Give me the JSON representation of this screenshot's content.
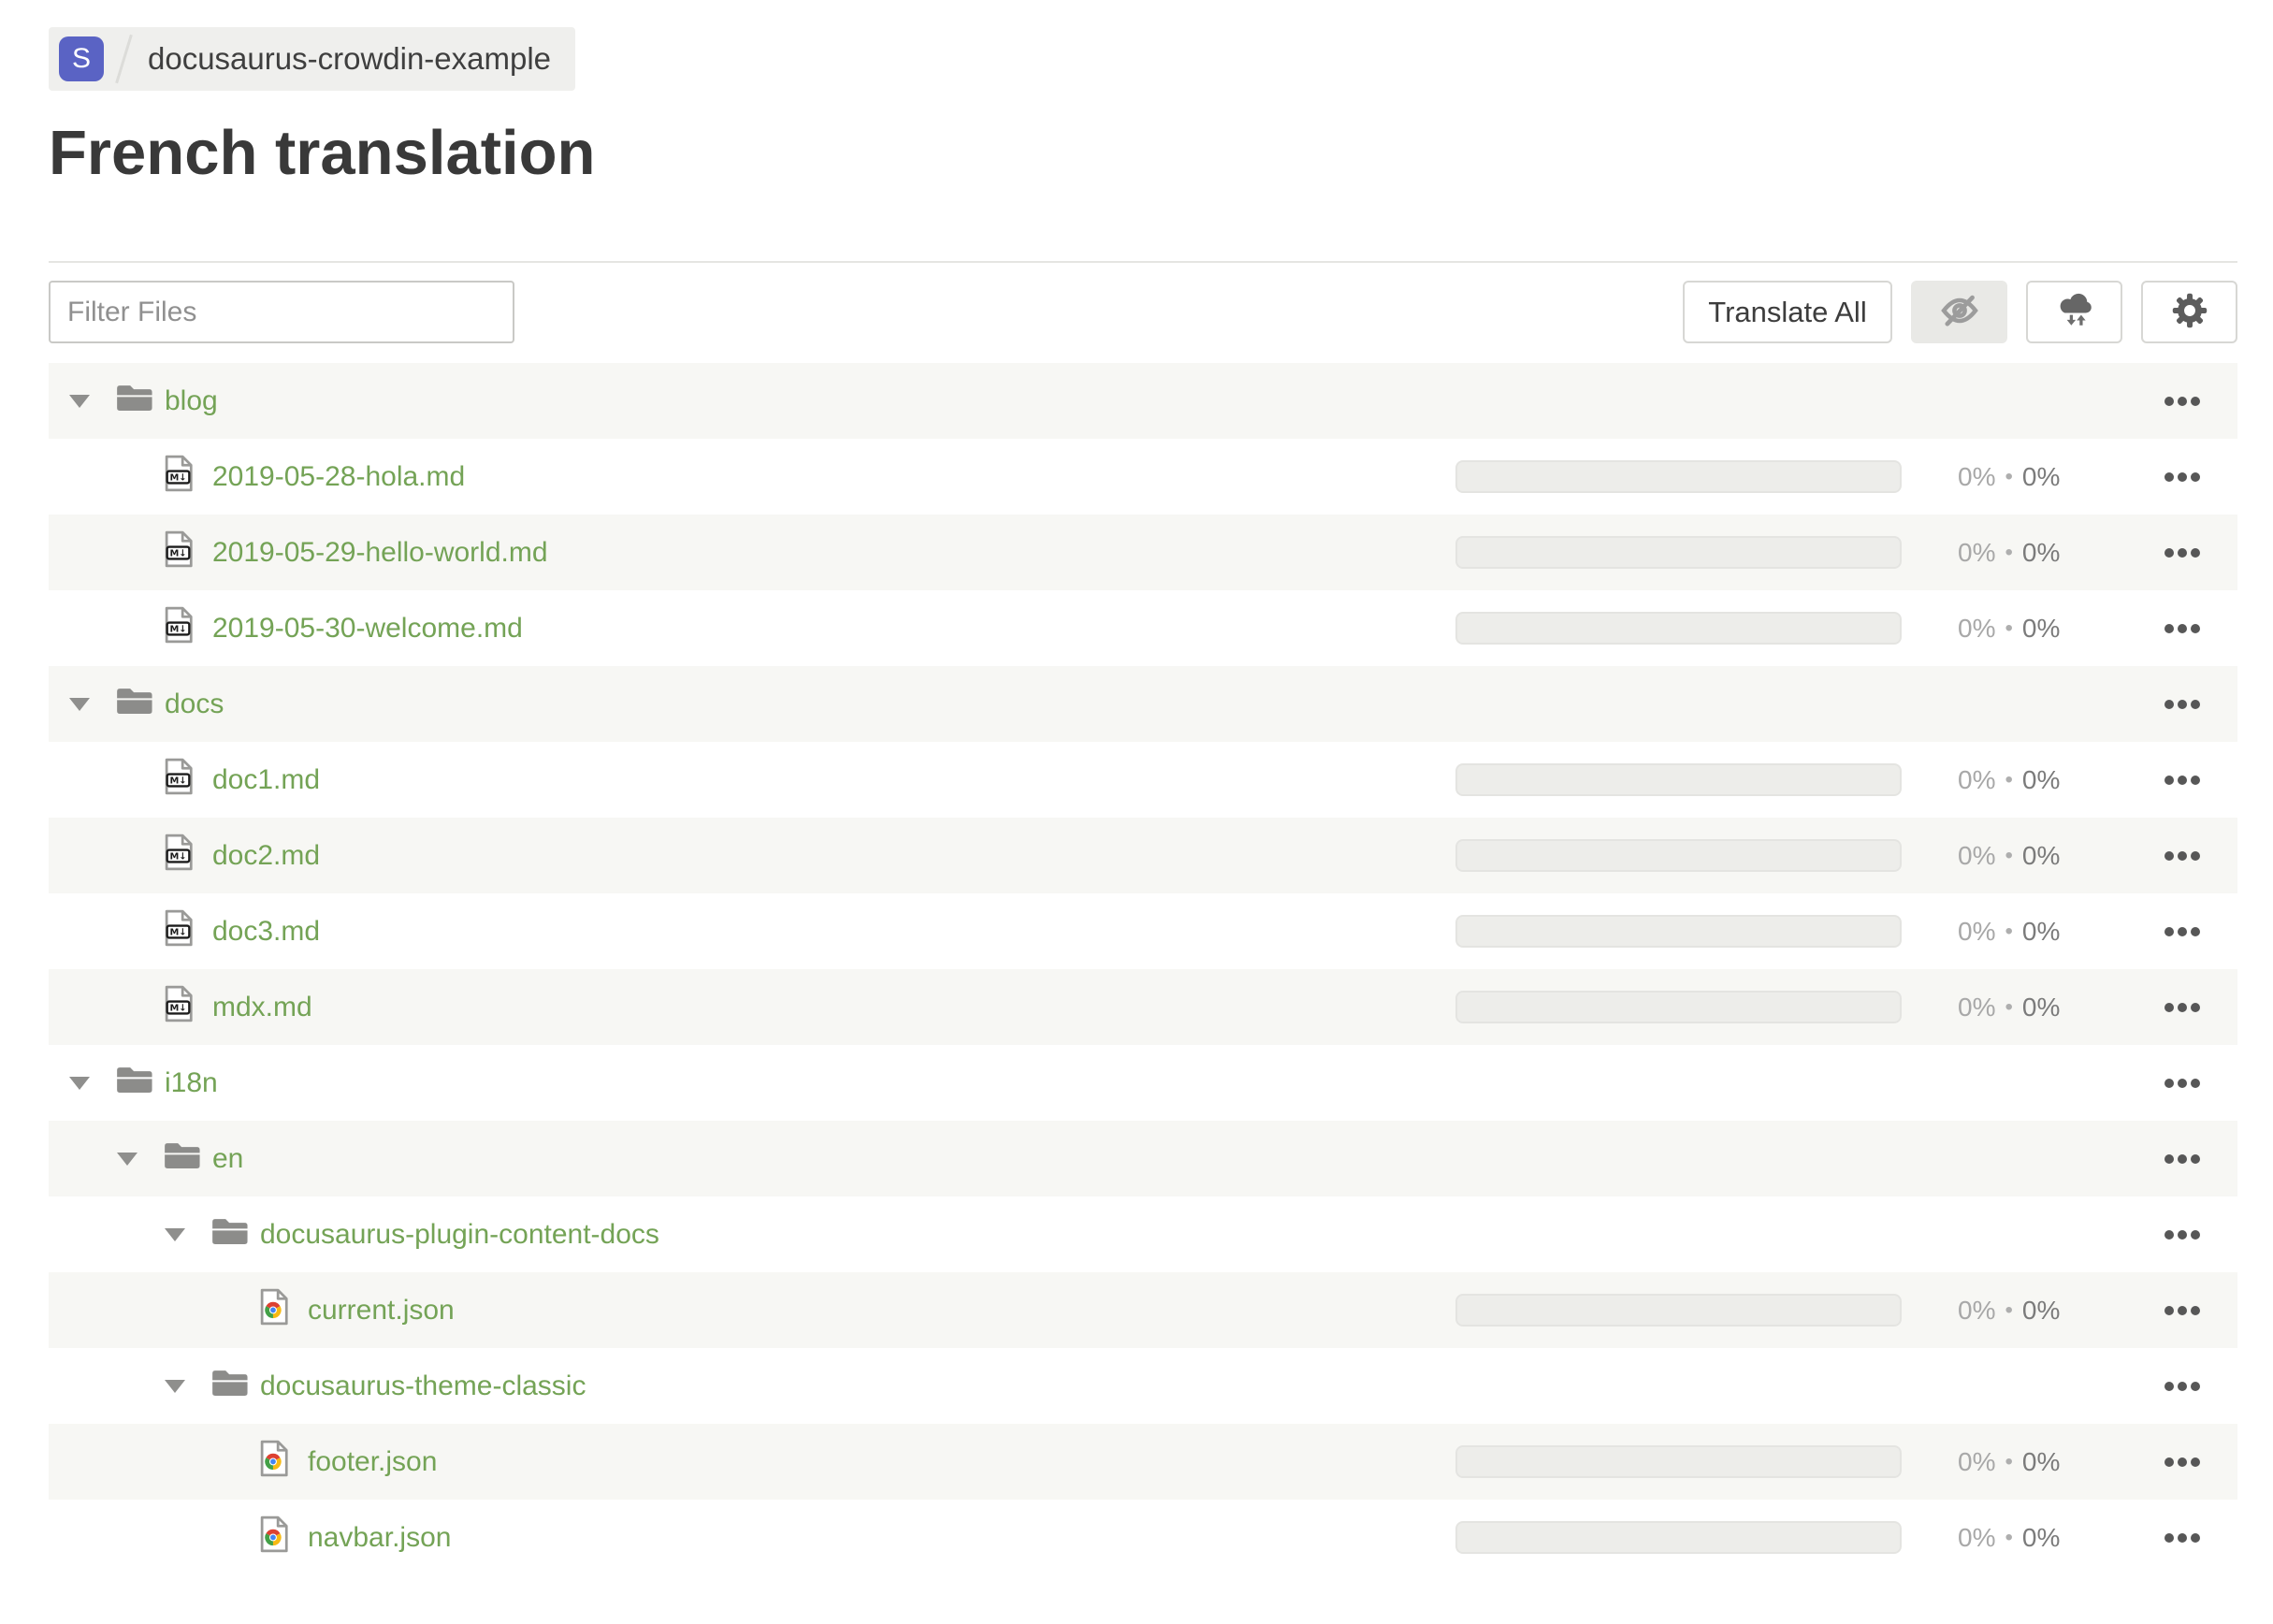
{
  "breadcrumb": {
    "project_initial": "S",
    "project_name": "docusaurus-crowdin-example"
  },
  "page": {
    "title": "French translation"
  },
  "toolbar": {
    "filter_placeholder": "Filter Files",
    "translate_all_label": "Translate All",
    "icon_buttons": [
      {
        "icon": "hide-completed-eye-off-icon",
        "active": true
      },
      {
        "icon": "download-upload-cloud-icon",
        "active": false
      },
      {
        "icon": "settings-gear-icon",
        "active": false
      }
    ]
  },
  "colors": {
    "badge_indigo": "#5a63c4",
    "link_green": "#74a356",
    "shaded_row": "#f7f7f4",
    "progress_track": "#ededea",
    "pct_translated_gray": "#a8a8a8",
    "pct_approved_gray": "#7b7b7b"
  },
  "progress_defaults": {
    "separator": "•"
  },
  "file_tree": {
    "rows": [
      {
        "type": "folder",
        "name": "blog",
        "depth": 0,
        "expanded": true,
        "shaded": true
      },
      {
        "type": "file",
        "icon": "markdown-file-icon",
        "name": "2019-05-28-hola.md",
        "depth": 1,
        "shaded": false,
        "progress": {
          "translated": "0%",
          "approved": "0%"
        }
      },
      {
        "type": "file",
        "icon": "markdown-file-icon",
        "name": "2019-05-29-hello-world.md",
        "depth": 1,
        "shaded": true,
        "progress": {
          "translated": "0%",
          "approved": "0%"
        }
      },
      {
        "type": "file",
        "icon": "markdown-file-icon",
        "name": "2019-05-30-welcome.md",
        "depth": 1,
        "shaded": false,
        "progress": {
          "translated": "0%",
          "approved": "0%"
        }
      },
      {
        "type": "folder",
        "name": "docs",
        "depth": 0,
        "expanded": true,
        "shaded": true
      },
      {
        "type": "file",
        "icon": "markdown-file-icon",
        "name": "doc1.md",
        "depth": 1,
        "shaded": false,
        "progress": {
          "translated": "0%",
          "approved": "0%"
        }
      },
      {
        "type": "file",
        "icon": "markdown-file-icon",
        "name": "doc2.md",
        "depth": 1,
        "shaded": true,
        "progress": {
          "translated": "0%",
          "approved": "0%"
        }
      },
      {
        "type": "file",
        "icon": "markdown-file-icon",
        "name": "doc3.md",
        "depth": 1,
        "shaded": false,
        "progress": {
          "translated": "0%",
          "approved": "0%"
        }
      },
      {
        "type": "file",
        "icon": "markdown-file-icon",
        "name": "mdx.md",
        "depth": 1,
        "shaded": true,
        "progress": {
          "translated": "0%",
          "approved": "0%"
        }
      },
      {
        "type": "folder",
        "name": "i18n",
        "depth": 0,
        "expanded": true,
        "shaded": false
      },
      {
        "type": "folder",
        "name": "en",
        "depth": 1,
        "expanded": true,
        "shaded": true
      },
      {
        "type": "folder",
        "name": "docusaurus-plugin-content-docs",
        "depth": 2,
        "expanded": true,
        "shaded": false
      },
      {
        "type": "file",
        "icon": "json-file-icon",
        "name": "current.json",
        "depth": 3,
        "shaded": true,
        "progress": {
          "translated": "0%",
          "approved": "0%"
        }
      },
      {
        "type": "folder",
        "name": "docusaurus-theme-classic",
        "depth": 2,
        "expanded": true,
        "shaded": false
      },
      {
        "type": "file",
        "icon": "json-file-icon",
        "name": "footer.json",
        "depth": 3,
        "shaded": true,
        "progress": {
          "translated": "0%",
          "approved": "0%"
        }
      },
      {
        "type": "file",
        "icon": "json-file-icon",
        "name": "navbar.json",
        "depth": 3,
        "shaded": false,
        "progress": {
          "translated": "0%",
          "approved": "0%"
        }
      }
    ]
  }
}
